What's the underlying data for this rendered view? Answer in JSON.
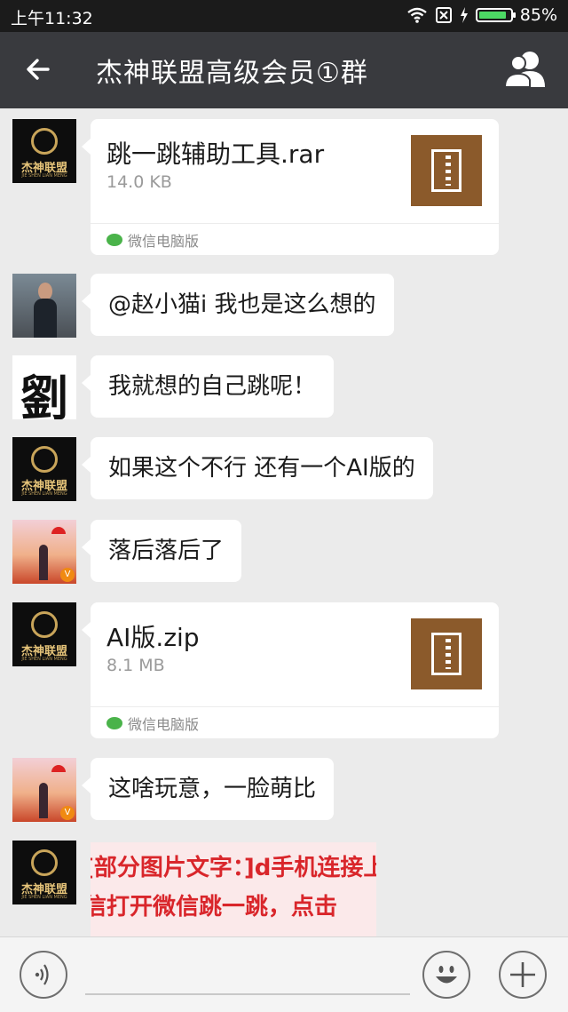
{
  "status_bar": {
    "time": "上午11:32",
    "battery": "85%"
  },
  "header": {
    "title": "杰神联盟高级会员①群"
  },
  "avatar_text": {
    "logo": "杰神联盟",
    "logo_sub": "JIE SHEN LIAN MENG",
    "calligraphy": "劉",
    "badge": "V"
  },
  "messages": [
    {
      "type": "file",
      "file_name": "跳一跳辅助工具.rar",
      "file_size": "14.0 KB",
      "source": "微信电脑版"
    },
    {
      "type": "text",
      "text": "@赵小猫i 我也是这么想的"
    },
    {
      "type": "text",
      "text": "我就想的自己跳呢！"
    },
    {
      "type": "text",
      "text": "如果这个不行 还有一个AI版的"
    },
    {
      "type": "text",
      "text": "落后落后了"
    },
    {
      "type": "file",
      "file_name": "AI版.zip",
      "file_size": "8.1 MB",
      "source": "微信电脑版"
    },
    {
      "type": "text",
      "text": "这啥玩意，一脸萌比"
    },
    {
      "type": "image",
      "lines": [
        "[部分图片文字：]d手机连接上电脑后开启调",
        "信打开微信跳一跳，点击"
      ]
    }
  ],
  "colors": {
    "header_bg": "#393a3e",
    "chat_bg": "#ebebeb",
    "file_icon": "#8b5a2b",
    "battery": "#4cd964"
  }
}
